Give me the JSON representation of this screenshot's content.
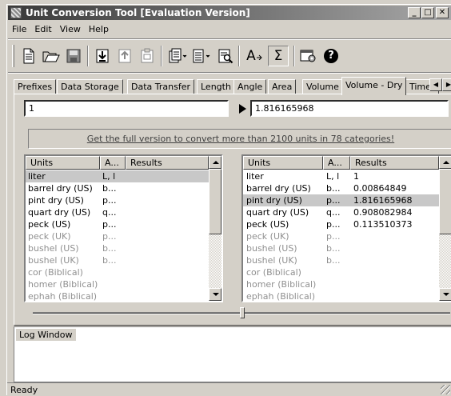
{
  "window": {
    "title": "Unit Conversion Tool [Evaluation Version]"
  },
  "title_buttons": {
    "minimize": "_",
    "maximize": "□",
    "close": "✕"
  },
  "menu": [
    "File",
    "Edit",
    "View",
    "Help"
  ],
  "toolbar": {
    "icons": [
      "new-document-icon",
      "open-folder-icon",
      "save-icon",
      "import-icon",
      "export-icon",
      "paste-icon",
      "copy-icon",
      "print-icon",
      "print-preview-icon",
      "font-icon",
      "sum-icon",
      "settings-icon",
      "help-icon"
    ],
    "font_label": "A",
    "sum_label": "Σ",
    "help_label": "?"
  },
  "tabs": [
    "Prefixes",
    "Data Storage",
    "Data Transfer",
    "Length",
    "Angle",
    "Area",
    "Volume",
    "Volume - Dry",
    "Time"
  ],
  "active_tab": "Volume - Dry",
  "tab_scroll": {
    "left": "◀",
    "right": "▶"
  },
  "input_value": "1",
  "output_value": "1.816165968",
  "promo_link": "Get the full version to convert more than 2100 units in 78 categories!",
  "columns": {
    "units": "Units",
    "abbr": "A...",
    "results": "Results"
  },
  "left_list": [
    {
      "unit": "liter",
      "abbr": "L, l",
      "result": ""
    },
    {
      "unit": "barrel dry (US)",
      "abbr": "b...",
      "result": ""
    },
    {
      "unit": "pint dry (US)",
      "abbr": "p...",
      "result": ""
    },
    {
      "unit": "quart dry (US)",
      "abbr": "q...",
      "result": ""
    },
    {
      "unit": "peck (US)",
      "abbr": "p...",
      "result": ""
    },
    {
      "unit": "peck (UK)",
      "abbr": "p...",
      "result": ""
    },
    {
      "unit": "bushel (US)",
      "abbr": "b...",
      "result": ""
    },
    {
      "unit": "bushel (UK)",
      "abbr": "b...",
      "result": ""
    },
    {
      "unit": "cor (Biblical)",
      "abbr": "",
      "result": ""
    },
    {
      "unit": "homer (Biblical)",
      "abbr": "",
      "result": ""
    },
    {
      "unit": "ephah (Biblical)",
      "abbr": "",
      "result": ""
    }
  ],
  "right_list": [
    {
      "unit": "liter",
      "abbr": "L, l",
      "result": "1"
    },
    {
      "unit": "barrel dry (US)",
      "abbr": "b...",
      "result": "0.00864849"
    },
    {
      "unit": "pint dry (US)",
      "abbr": "p...",
      "result": "1.816165968"
    },
    {
      "unit": "quart dry (US)",
      "abbr": "q...",
      "result": "0.908082984"
    },
    {
      "unit": "peck (US)",
      "abbr": "p...",
      "result": "0.113510373"
    },
    {
      "unit": "peck (UK)",
      "abbr": "p...",
      "result": ""
    },
    {
      "unit": "bushel (US)",
      "abbr": "b...",
      "result": ""
    },
    {
      "unit": "bushel (UK)",
      "abbr": "b...",
      "result": ""
    },
    {
      "unit": "cor (Biblical)",
      "abbr": "",
      "result": ""
    },
    {
      "unit": "homer (Biblical)",
      "abbr": "",
      "result": ""
    },
    {
      "unit": "ephah (Biblical)",
      "abbr": "",
      "result": ""
    }
  ],
  "left_selected": 0,
  "right_selected": 2,
  "gray_from_index": 5,
  "log_window_label": "Log Window",
  "status_text": "Ready"
}
